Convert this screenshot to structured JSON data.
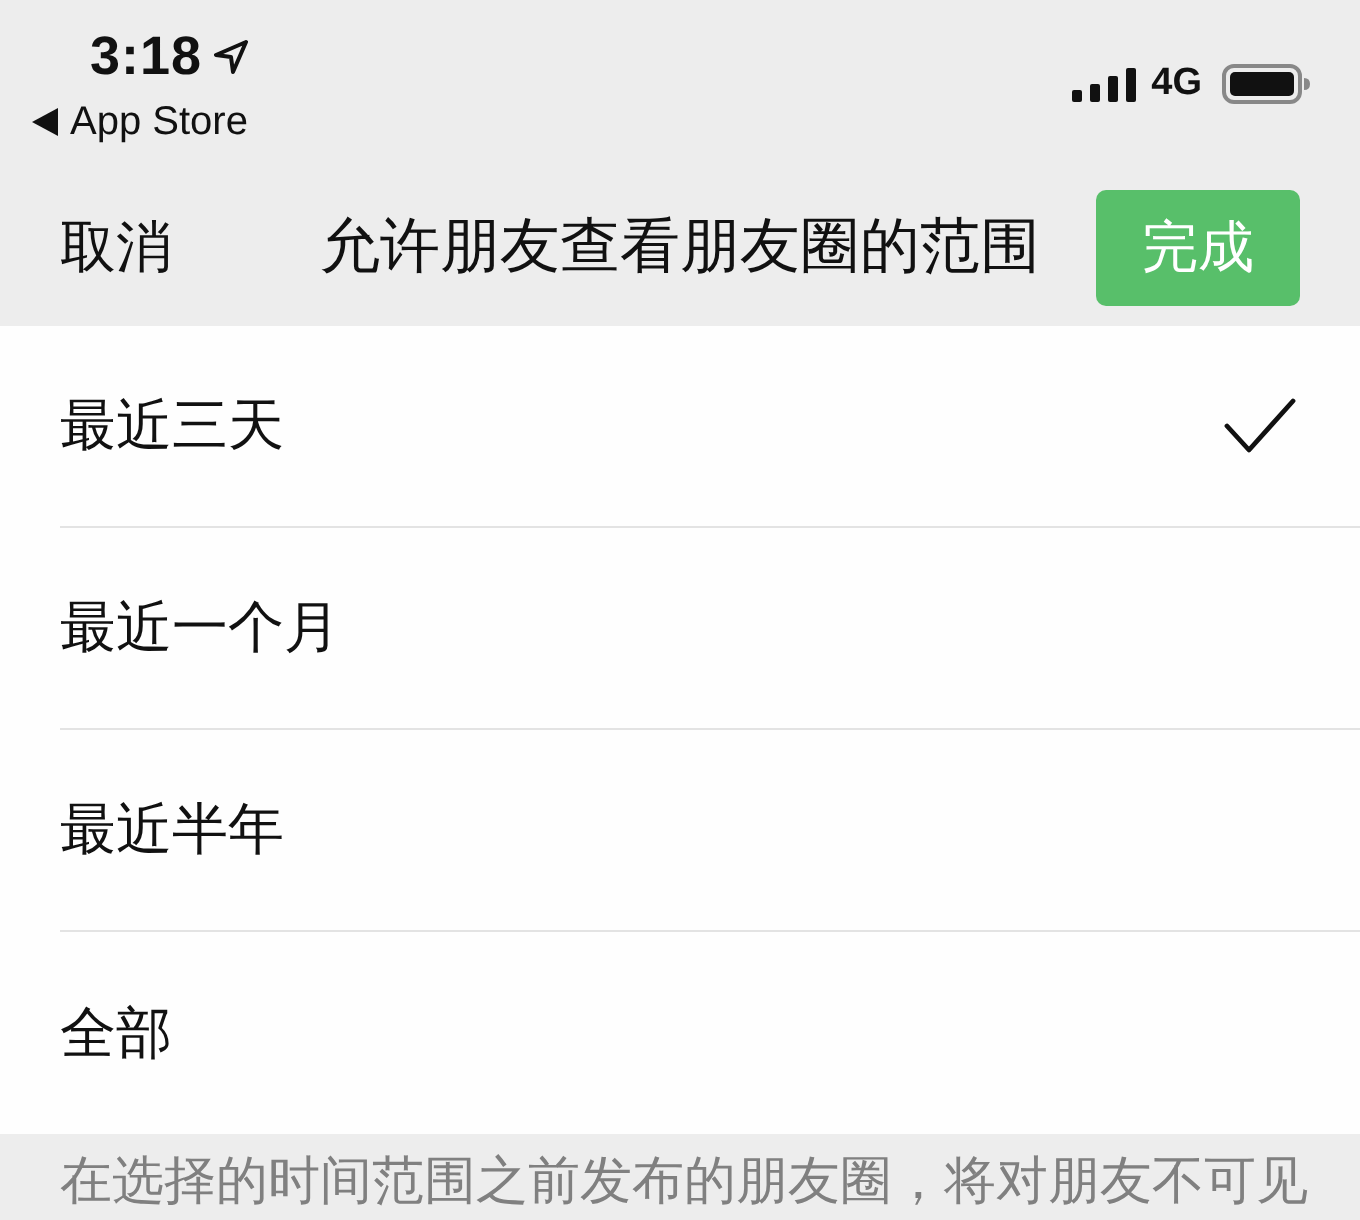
{
  "status_bar": {
    "time": "3:18",
    "back_label": "App Store",
    "network": "4G"
  },
  "nav_bar": {
    "cancel": "取消",
    "title": "允许朋友查看朋友圈的范围",
    "done": "完成"
  },
  "options": [
    {
      "label": "最近三天",
      "selected": true
    },
    {
      "label": "最近一个月",
      "selected": false
    },
    {
      "label": "最近半年",
      "selected": false
    },
    {
      "label": "全部",
      "selected": false
    }
  ],
  "footer_note": "在选择的时间范围之前发布的朋友圈，将对朋友不可见"
}
